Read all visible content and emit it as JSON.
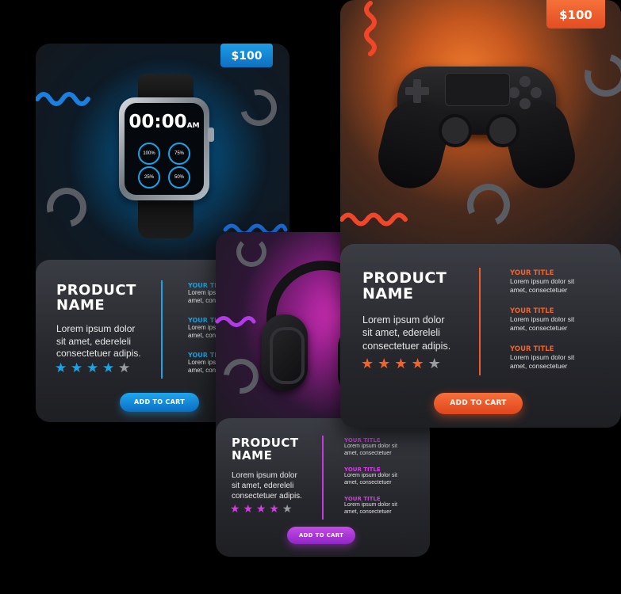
{
  "colors": {
    "watch_accent": "#1aa3e6",
    "controller_accent": "#f25a2a",
    "headphones_accent": "#c23be0"
  },
  "cards": {
    "watch": {
      "price": "$100",
      "name_line1": "PRODUCT",
      "name_line2": "NAME",
      "desc_lines": [
        "Lorem ipsum dolor",
        "sit amet, edereleli",
        "consectetuer adipis."
      ],
      "rating": 4,
      "max_rating": 5,
      "features": [
        {
          "title": "YOUR TITLE",
          "line1": "Lorem ipsum dolor sit",
          "line2": "amet, consectetuer"
        },
        {
          "title": "YOUR TITLE",
          "line1": "Lorem ipsum dolor sit",
          "line2": "amet, consectetuer"
        },
        {
          "title": "YOUR TITLE",
          "line1": "Lorem ipsum dolor sit",
          "line2": "amet, consectetuer"
        }
      ],
      "button": "ADD TO CART",
      "watch_time": "00:00",
      "watch_ampm": "AM",
      "watch_dials": [
        "100%",
        "75%",
        "25%",
        "50%"
      ]
    },
    "controller": {
      "price": "$100",
      "name_line1": "PRODUCT",
      "name_line2": "NAME",
      "desc_lines": [
        "Lorem ipsum dolor",
        "sit amet, edereleli",
        "consectetuer adipis."
      ],
      "rating": 4,
      "max_rating": 5,
      "features": [
        {
          "title": "YOUR TITLE",
          "line1": "Lorem ipsum dolor sit",
          "line2": "amet, consectetuer"
        },
        {
          "title": "YOUR TITLE",
          "line1": "Lorem ipsum dolor sit",
          "line2": "amet, consectetuer"
        },
        {
          "title": "YOUR TITLE",
          "line1": "Lorem ipsum dolor sit",
          "line2": "amet, consectetuer"
        }
      ],
      "button": "ADD TO CART"
    },
    "headphones": {
      "name_line1": "PRODUCT",
      "name_line2": "NAME",
      "desc_lines": [
        "Lorem ipsum dolor",
        "sit amet, edereleli",
        "consectetuer adipis."
      ],
      "rating": 4,
      "max_rating": 5,
      "features": [
        {
          "title": "YOUR TITLE",
          "line1": "Lorem ipsum dolor sit",
          "line2": "amet, consectetuer"
        },
        {
          "title": "YOUR TITLE",
          "line1": "Lorem ipsum dolor sit",
          "line2": "amet, consectetuer"
        },
        {
          "title": "YOUR TITLE",
          "line1": "Lorem ipsum dolor sit",
          "line2": "amet, consectetuer"
        }
      ],
      "button": "ADD TO CART"
    }
  }
}
